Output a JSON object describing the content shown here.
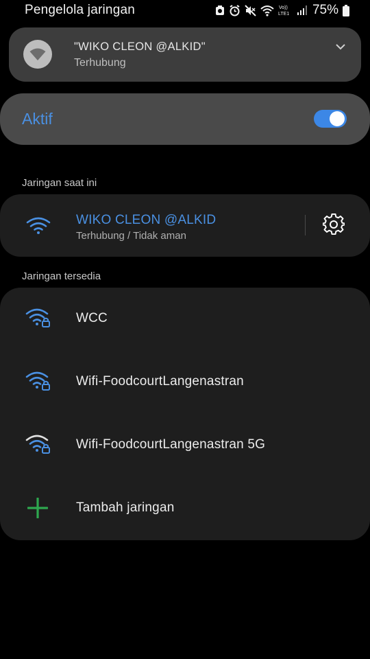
{
  "status_bar": {
    "title": "Pengelola jaringan",
    "battery_percent": "75%",
    "volte_label": "Vo)) LTE1",
    "icons": [
      "sync-icon",
      "alarm-icon",
      "mute-icon",
      "wifi-signal-icon",
      "volte-icon",
      "cell-signal-icon",
      "battery-icon"
    ]
  },
  "connected_card": {
    "network_name": "\"WIKO CLEON @ALKID\"",
    "status": "Terhubung",
    "icon": "wifi-badge-icon",
    "expand_icon": "chevron-down-icon"
  },
  "wifi_toggle": {
    "label": "Aktif",
    "enabled": true,
    "accent_color": "#3c87e6"
  },
  "current_section": {
    "header": "Jaringan saat ini",
    "network": {
      "name": "WIKO CLEON @ALKID",
      "status": "Terhubung / Tidak aman",
      "icon": "wifi-icon",
      "settings_icon": "gear-icon"
    }
  },
  "available_section": {
    "header": "Jaringan tersedia",
    "networks": [
      {
        "name": "WCC",
        "icon": "wifi-lock-icon"
      },
      {
        "name": "Wifi-FoodcourtLangenastran",
        "icon": "wifi-lock-icon"
      },
      {
        "name": "Wifi-FoodcourtLangenastran 5G",
        "icon": "wifi-lock-icon"
      }
    ],
    "add_network": {
      "label": "Tambah jaringan",
      "icon": "plus-icon"
    }
  },
  "colors": {
    "accent_blue": "#4a90e2",
    "add_green": "#2ea84f",
    "background": "#000000",
    "card": "#1e1e1e"
  }
}
